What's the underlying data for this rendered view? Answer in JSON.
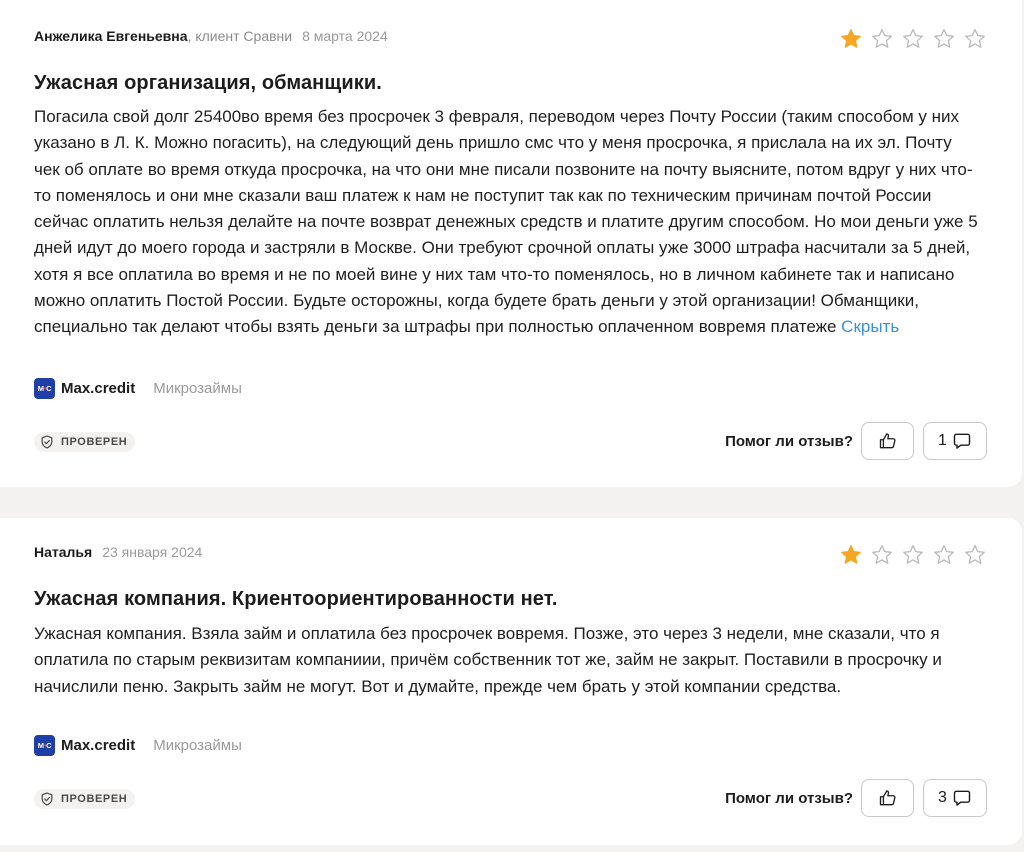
{
  "reviews": [
    {
      "author": "Анжелика Евгеньевна",
      "author_suffix": ", клиент Сравни",
      "date": "8 марта 2024",
      "rating": 1,
      "title": "Ужасная организация, обманщики.",
      "text": "Погасила свой долг 25400во время без просрочек 3 февраля, переводом через Почту России (таким способом у них указано в Л. К. Можно погасить), на следующий день пришло смс что у меня просрочка, я прислала на их эл. Почту чек об оплате во время откуда просрочка, на что они мне писали позвоните на почту выясните, потом вдруг у них что-то поменялось и они мне сказали ваш платеж к нам не поступит так как по техническим причинам почтой России сейчас оплатить нельзя делайте на почте возврат денежных средств и платите другим способом. Но мои деньги уже 5 дней идут до моего города и застряли в Москве. Они требуют срочной оплаты уже 3000 штрафа насчитали за 5 дней, хотя я все оплатила во время и не по моей вине у них там что-то поменялось, но в личном кабинете так и написано можно оплатить Постой России. Будьте осторожны, когда будете брать деньги у этой организации! Обманщики, специально так делают чтобы взять деньги за штрафы при полностью оплаченном вовремя платеже",
      "hide_label": "Скрыть",
      "company": "Max.credit",
      "category": "Микрозаймы",
      "verified": "ПРОВЕРЕН",
      "helpful_label": "Помог ли отзыв?",
      "comments": "1"
    },
    {
      "author": "Наталья",
      "author_suffix": "",
      "date": "23 января 2024",
      "rating": 1,
      "title": "Ужасная компания. Криентоориентированности нет.",
      "text": "Ужасная компания. Взяла займ и оплатила без просрочек вовремя. Позже, это через 3 недели, мне сказали, что я оплатила по старым реквизитам компаниии, причём собственник тот же, займ не закрыт. Поставили в просрочку и начислили пеню. Закрыть займ не могут. Вот и думайте, прежде чем брать у этой компании средства.",
      "company": "Max.credit",
      "category": "Микрозаймы",
      "verified": "ПРОВЕРЕН",
      "helpful_label": "Помог ли отзыв?",
      "comments": "3"
    }
  ],
  "logo_text": {
    "left": "M",
    "dot": "•",
    "right": "C"
  },
  "colors": {
    "star_filled": "#f5a623",
    "star_empty": "#b9b9b9",
    "link": "#3a8fe0",
    "logo_bg": "#1f3fa8"
  },
  "icons": {
    "star": "star-icon",
    "verified": "shield-check-icon",
    "like": "thumbs-up-icon",
    "comment": "comment-bubble-icon"
  }
}
